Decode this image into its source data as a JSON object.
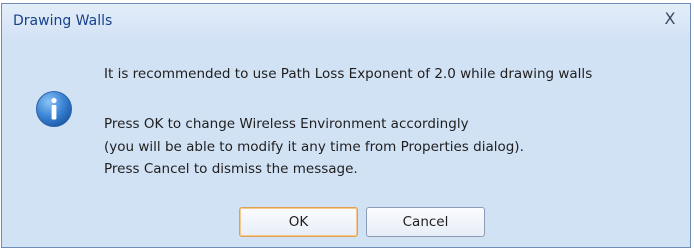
{
  "dialog": {
    "title": "Drawing Walls",
    "close_glyph": "X",
    "icon": "info-icon",
    "message_lines": [
      "It is recommended to use Path Loss Exponent of 2.0 while drawing walls",
      "Press OK to change Wireless  Environment accordingly",
      "(you will be able to modify it any time from Properties dialog).",
      "Press Cancel to dismiss the message."
    ],
    "buttons": {
      "ok_label": "OK",
      "cancel_label": "Cancel"
    }
  },
  "colors": {
    "dialog_background": "#d2e2f5",
    "title_text": "#15428b",
    "info_icon": "#2f74c9",
    "default_button_border": "#e1a04e"
  }
}
